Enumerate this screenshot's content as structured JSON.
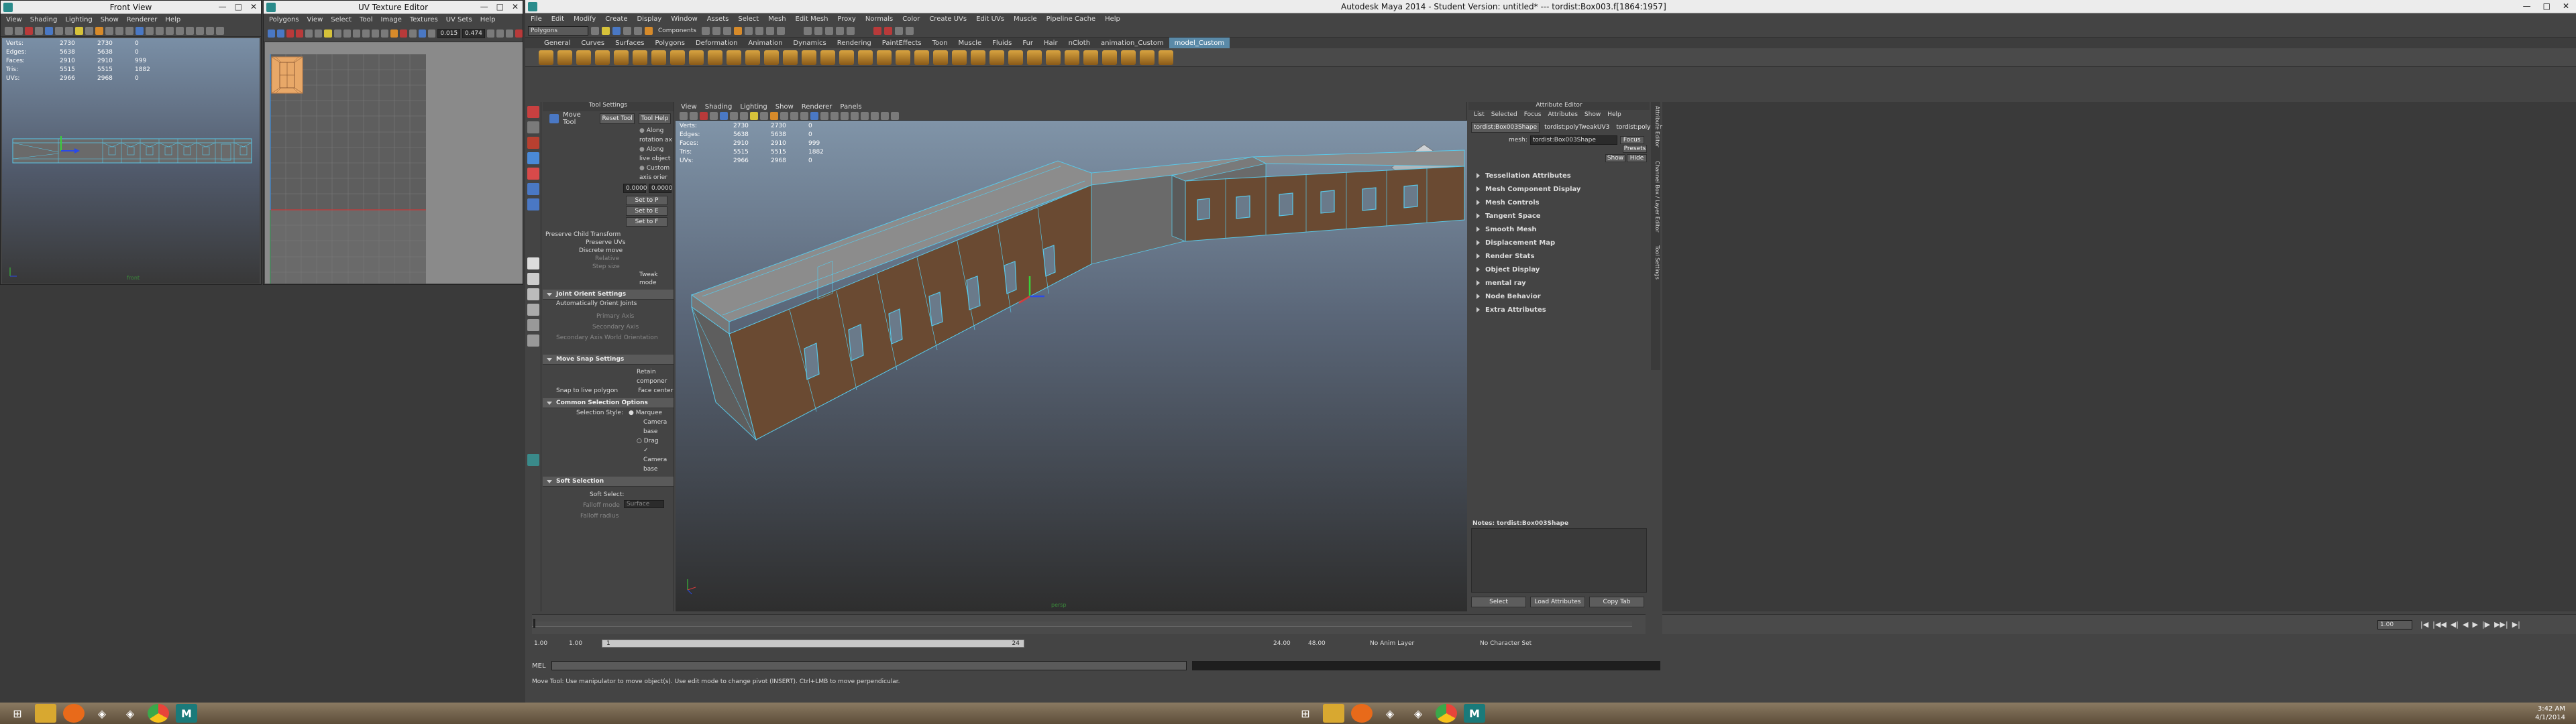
{
  "front_view": {
    "title": "Front View",
    "menu": [
      "View",
      "Shading",
      "Lighting",
      "Show",
      "Renderer",
      "Help"
    ],
    "hud": [
      {
        "label": "Verts:",
        "a": "2730",
        "b": "2730",
        "c": "0"
      },
      {
        "label": "Edges:",
        "a": "5638",
        "b": "5638",
        "c": "0"
      },
      {
        "label": "Faces:",
        "a": "2910",
        "b": "2910",
        "c": "999"
      },
      {
        "label": "Tris:",
        "a": "5515",
        "b": "5515",
        "c": "1882"
      },
      {
        "label": "UVs:",
        "a": "2966",
        "b": "2968",
        "c": "0"
      }
    ],
    "camera_label": "front"
  },
  "uv_editor": {
    "title": "UV Texture Editor",
    "menu": [
      "Polygons",
      "View",
      "Select",
      "Tool",
      "Image",
      "Textures",
      "UV Sets",
      "Help"
    ],
    "field1": "0.015",
    "field2": "0.474"
  },
  "maya": {
    "title": "Autodesk Maya 2014 - Student Version: untitled*   ---   tordist:Box003.f[1864:1957]",
    "menu": [
      "File",
      "Edit",
      "Modify",
      "Create",
      "Display",
      "Window",
      "Assets",
      "Select",
      "Mesh",
      "Edit Mesh",
      "Proxy",
      "Normals",
      "Color",
      "Create UVs",
      "Edit UVs",
      "Muscle",
      "Pipeline Cache",
      "Help"
    ],
    "mode_select": "Polygons",
    "components_label": "Components",
    "shelf_tabs": [
      "General",
      "Curves",
      "Surfaces",
      "Polygons",
      "Deformation",
      "Animation",
      "Dynamics",
      "Rendering",
      "PaintEffects",
      "Toon",
      "Muscle",
      "Fluids",
      "Fur",
      "Hair",
      "nCloth",
      "animation_Custom",
      "model_Custom"
    ],
    "active_shelf": "model_Custom",
    "tool_settings": {
      "header": "Tool Settings",
      "tool_name": "Move Tool",
      "reset_btn": "Reset Tool",
      "help_btn": "Tool Help",
      "options": [
        "Along rotation ax",
        "Along live object",
        "Custom axis orier"
      ],
      "num1": "0.0000",
      "num2": "0.0000",
      "set_buttons": [
        "Set to P",
        "Set to E",
        "Set to F"
      ],
      "preserve_child": "Preserve Child Transform",
      "preserve_uvs": "Preserve UVs",
      "discrete_move": "Discrete move",
      "relative": "Relative",
      "step_size": "Step size",
      "tweak_mode": "Tweak mode",
      "joint_orient_header": "Joint Orient Settings",
      "auto_orient": "Automatically Orient Joints",
      "primary_axis": "Primary Axis",
      "secondary_axis": "Secondary Axis",
      "secondary_world": "Secondary Axis World Orientation",
      "move_snap_header": "Move Snap Settings",
      "retain_component": "Retain componer",
      "snap_live": "Snap to live polygon",
      "face_center": "Face center",
      "common_sel_header": "Common Selection Options",
      "selection_style": "Selection Style:",
      "marquee": "Marquee",
      "camera_based": "Camera base",
      "drag": "Drag",
      "camera_based2": "Camera base",
      "soft_sel_header": "Soft Selection",
      "soft_select": "Soft Select:",
      "falloff_mode": "Falloff mode",
      "falloff_mode_val": "Surface",
      "falloff_radius": "Falloff radius"
    },
    "viewport": {
      "menu": [
        "View",
        "Shading",
        "Lighting",
        "Show",
        "Renderer",
        "Panels"
      ],
      "hud": [
        {
          "label": "Verts:",
          "a": "2730",
          "b": "2730",
          "c": "0"
        },
        {
          "label": "Edges:",
          "a": "5638",
          "b": "5638",
          "c": "0"
        },
        {
          "label": "Faces:",
          "a": "2910",
          "b": "2910",
          "c": "999"
        },
        {
          "label": "Tris:",
          "a": "5515",
          "b": "5515",
          "c": "1882"
        },
        {
          "label": "UVs:",
          "a": "2966",
          "b": "2968",
          "c": "0"
        }
      ],
      "camera_label": "persp"
    },
    "attr_editor": {
      "header": "Attribute Editor",
      "menu": [
        "List",
        "Selected",
        "Focus",
        "Attributes",
        "Show",
        "Help"
      ],
      "tabs": [
        "tordist:Box003Shape",
        "tordist:polyTweakUV3",
        "tordist:polyPlanarProj8"
      ],
      "mesh_label": "mesh:",
      "mesh_value": "tordist:Box003Shape",
      "focus_btn": "Focus",
      "presets_btn": "Presets",
      "show_btn": "Show",
      "hide_btn": "Hide",
      "sections": [
        "Tessellation Attributes",
        "Mesh Component Display",
        "Mesh Controls",
        "Tangent Space",
        "Smooth Mesh",
        "Displacement Map",
        "Render Stats",
        "Object Display",
        "mental ray",
        "Node Behavior",
        "Extra Attributes"
      ],
      "notes": "Notes: tordist:Box003Shape",
      "select_btn": "Select",
      "load_btn": "Load Attributes",
      "copy_btn": "Copy Tab"
    },
    "timeline": {
      "start_field": "1.00",
      "cur_field": "1.00",
      "range_start": "1",
      "range_end": "24",
      "end_field": "24.00",
      "end2_field": "48.00",
      "current_frame": "1.00",
      "anim_layer": "No Anim Layer",
      "char_set": "No Character Set"
    },
    "mel_label": "MEL",
    "help_line": "Move Tool: Use manipulator to move object(s). Use edit mode to change pivot (INSERT). Ctrl+LMB to move perpendicular.",
    "side_tabs": [
      "Attribute Editor",
      "Channel Box / Layer Editor",
      "Tool Settings"
    ]
  },
  "taskbar_left": [
    "windows-start",
    "explorer",
    "firefox",
    "unity",
    "unity2",
    "chrome",
    "maya"
  ],
  "taskbar_right": [
    "windows-start",
    "explorer",
    "firefox",
    "unity",
    "unity2",
    "chrome",
    "maya"
  ],
  "clock": {
    "time": "3:42 AM",
    "date": "4/1/2014"
  },
  "colors": {
    "uv_shell": "#e8a868",
    "wire": "#5ac8e8",
    "selected": "#d98a40"
  }
}
